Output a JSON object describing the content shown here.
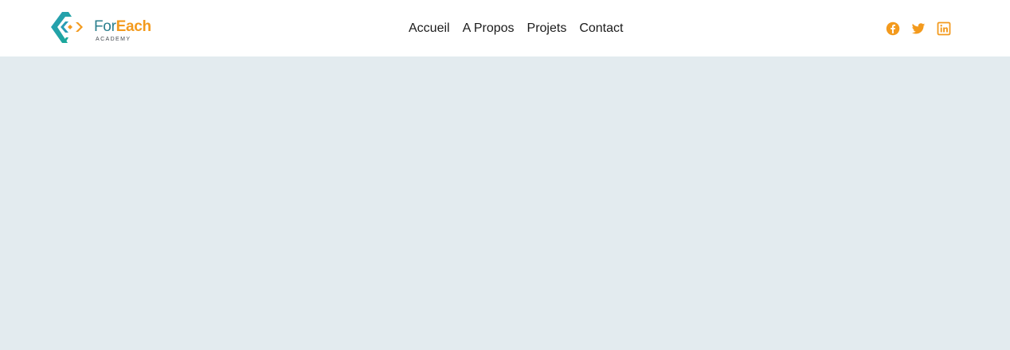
{
  "brand": {
    "name_part1": "For",
    "name_part2": "Each",
    "tagline": "ACADEMY",
    "colors": {
      "teal": "#2b7f8e",
      "orange": "#f39a1d"
    }
  },
  "nav": {
    "items": [
      {
        "label": "Accueil"
      },
      {
        "label": "A Propos"
      },
      {
        "label": "Projets"
      },
      {
        "label": "Contact"
      }
    ]
  },
  "social": {
    "color": "#f39a1d",
    "items": [
      {
        "icon": "facebook-icon"
      },
      {
        "icon": "twitter-icon"
      },
      {
        "icon": "linkedin-icon"
      }
    ]
  },
  "hero": {
    "background": "#e3ebef"
  }
}
